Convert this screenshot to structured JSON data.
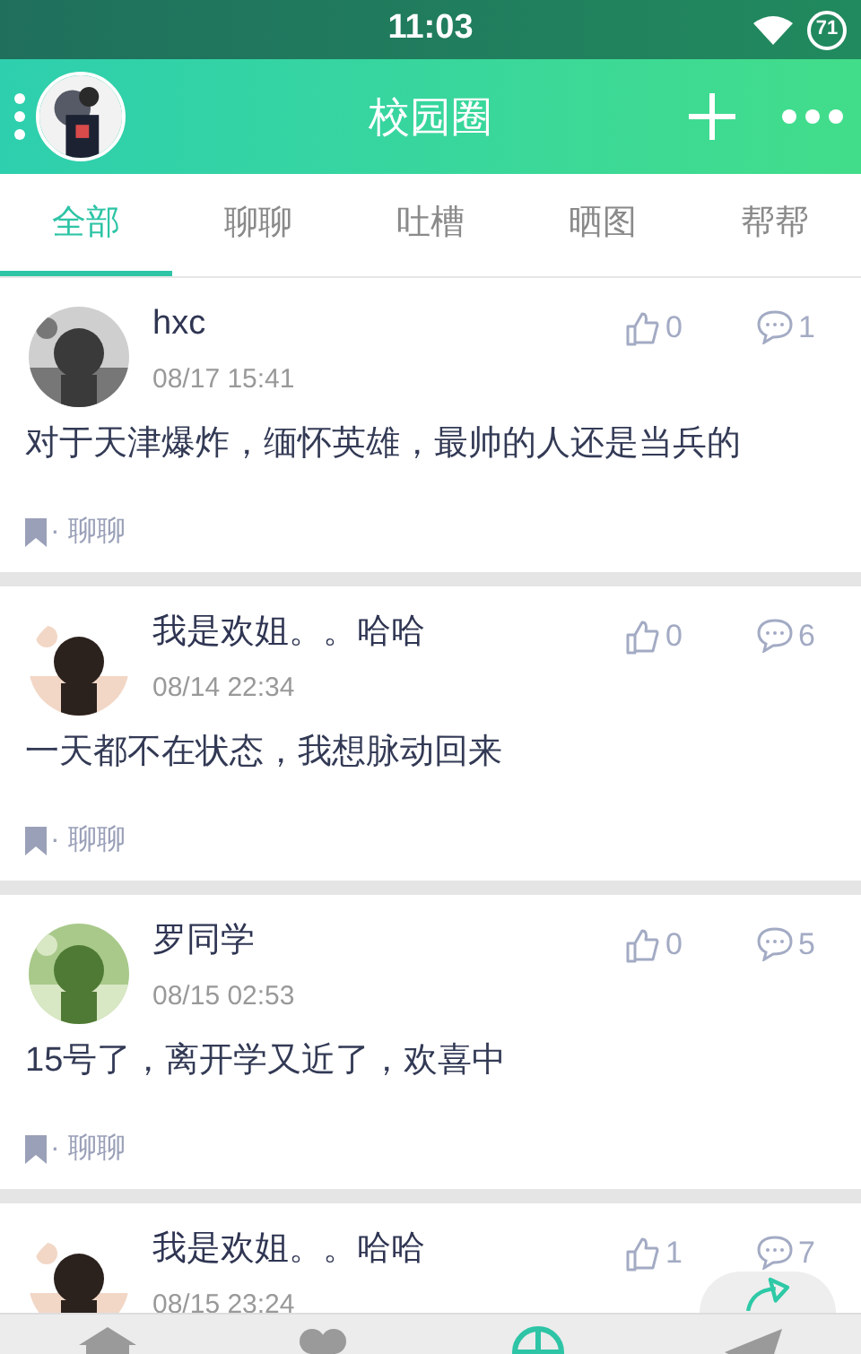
{
  "status_bar": {
    "time": "11:03",
    "battery": "71"
  },
  "header": {
    "title": "校园圈"
  },
  "tabs": [
    {
      "label": "全部",
      "selected": true
    },
    {
      "label": "聊聊",
      "selected": false
    },
    {
      "label": "吐槽",
      "selected": false
    },
    {
      "label": "晒图",
      "selected": false
    },
    {
      "label": "帮帮",
      "selected": false
    }
  ],
  "posts": [
    {
      "author": "hxc",
      "time": "08/17 15:41",
      "likes": "0",
      "comments": "1",
      "text": "对于天津爆炸，缅怀英雄，最帅的人还是当兵的",
      "tag": "· 聊聊"
    },
    {
      "author": "我是欢姐。。哈哈",
      "time": "08/14 22:34",
      "likes": "0",
      "comments": "6",
      "text": "一天都不在状态，我想脉动回来",
      "tag": "· 聊聊"
    },
    {
      "author": "罗同学",
      "time": "08/15 02:53",
      "likes": "0",
      "comments": "5",
      "text": "15号了，离开学又近了，欢喜中",
      "tag": "· 聊聊"
    },
    {
      "author": "我是欢姐。。哈哈",
      "time": "08/15 23:24",
      "likes": "1",
      "comments": "7"
    }
  ],
  "bottom_nav": [
    {
      "kind": "house",
      "selected": false
    },
    {
      "kind": "clover",
      "selected": false
    },
    {
      "kind": "globe",
      "selected": true
    },
    {
      "kind": "plane",
      "selected": false
    }
  ]
}
